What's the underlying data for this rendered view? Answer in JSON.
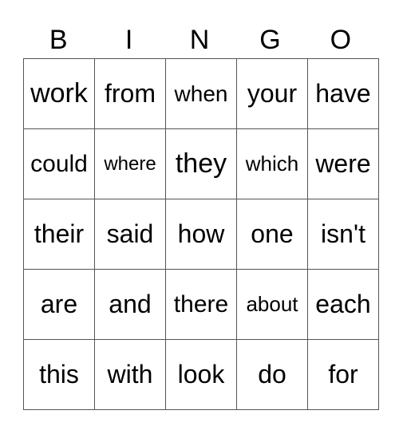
{
  "header": [
    "B",
    "I",
    "N",
    "G",
    "O"
  ],
  "rows": [
    [
      "work",
      "from",
      "when",
      "your",
      "have"
    ],
    [
      "could",
      "where",
      "they",
      "which",
      "were"
    ],
    [
      "their",
      "said",
      "how",
      "one",
      "isn't"
    ],
    [
      "are",
      "and",
      "there",
      "about",
      "each"
    ],
    [
      "this",
      "with",
      "look",
      "do",
      "for"
    ]
  ]
}
